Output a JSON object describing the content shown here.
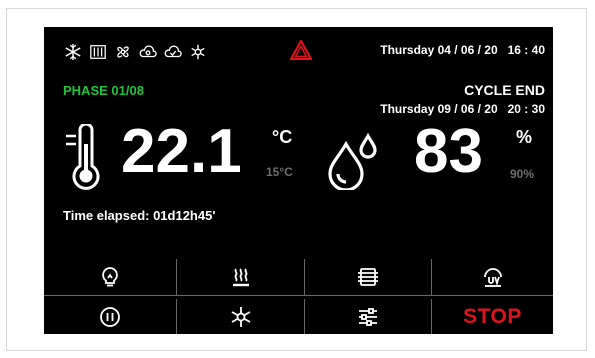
{
  "header": {
    "datetime": "Thursday 04 / 06 / 20   16 : 40",
    "icons": [
      "snowflake-icon",
      "heater-icon",
      "fan-icon",
      "gear-cloud-icon",
      "cloud-check-icon",
      "defrost-icon"
    ],
    "warning_icon": "warning-triangle-icon"
  },
  "status": {
    "phase": "PHASE 01/08",
    "cycle_end_label": "CYCLE END",
    "cycle_end_datetime": "Thursday 09 / 06 / 20   20 : 30",
    "elapsed": "Time elapsed: 01d12h45'"
  },
  "temperature": {
    "value": "22.1",
    "unit": "°C",
    "setpoint": "15°C"
  },
  "humidity": {
    "value": "83",
    "unit": "%",
    "setpoint": "90%"
  },
  "controls": {
    "stop_label": "STOP"
  },
  "colors": {
    "phase": "#22c53a",
    "warning": "#e0131b",
    "stop": "#e0131b",
    "setpoint": "#6d6d6d"
  }
}
